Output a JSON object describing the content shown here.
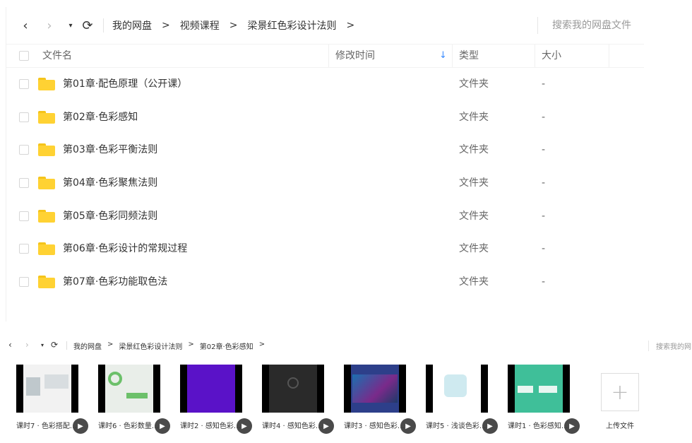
{
  "panel1": {
    "nav": {
      "back": "‹",
      "forward": "›",
      "dropdown": "▾",
      "refresh": "⟳"
    },
    "breadcrumb": [
      "我的网盘",
      "视频课程",
      "梁景红色彩设计法则"
    ],
    "breadcrumb_sep": ">",
    "search_placeholder": "搜索我的网盘文件",
    "columns": {
      "name": "文件名",
      "modified": "修改时间",
      "type": "类型",
      "size": "大小"
    },
    "sort_icon": "↓",
    "rows": [
      {
        "name": "第01章·配色原理（公开课）",
        "type": "文件夹",
        "size": "-"
      },
      {
        "name": "第02章·色彩感知",
        "type": "文件夹",
        "size": "-"
      },
      {
        "name": "第03章·色彩平衡法则",
        "type": "文件夹",
        "size": "-"
      },
      {
        "name": "第04章·色彩聚焦法则",
        "type": "文件夹",
        "size": "-"
      },
      {
        "name": "第05章·色彩同频法则",
        "type": "文件夹",
        "size": "-"
      },
      {
        "name": "第06章·色彩设计的常规过程",
        "type": "文件夹",
        "size": "-"
      },
      {
        "name": "第07章·色彩功能取色法",
        "type": "文件夹",
        "size": "-"
      }
    ]
  },
  "panel2": {
    "nav": {
      "back": "‹",
      "forward": "›",
      "dropdown": "▾",
      "refresh": "⟳"
    },
    "breadcrumb": [
      "我的网盘",
      "梁景红色彩设计法则",
      "第02章·色彩感知"
    ],
    "breadcrumb_sep": ">",
    "search_placeholder": "搜索我的网",
    "play_icon": "▶",
    "thumbnails": [
      {
        "caption": "课时7 · 色彩搭配...",
        "bg": "#f2f2f2"
      },
      {
        "caption": "课时6 · 色彩数量...",
        "bg": "#e9eee9"
      },
      {
        "caption": "课时2 · 感知色彩...",
        "bg": "#5a12c8"
      },
      {
        "caption": "课时4 · 感知色彩...",
        "bg": "#2a2a2a"
      },
      {
        "caption": "课时3 · 感知色彩...",
        "bg": "#2d3f8a"
      },
      {
        "caption": "课时5 · 浅谈色彩...",
        "bg": "#ffffff"
      },
      {
        "caption": "课时1 · 色彩感知...",
        "bg": "#3fbf99"
      }
    ],
    "upload": {
      "icon": "+",
      "label": "上传文件"
    }
  }
}
